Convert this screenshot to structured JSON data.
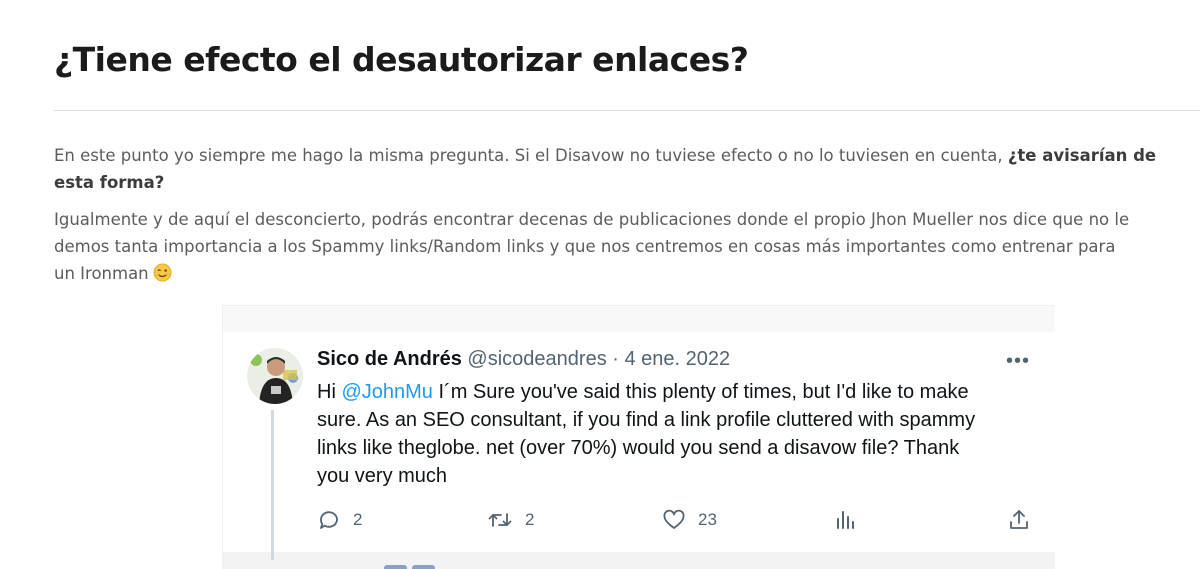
{
  "article": {
    "heading": "¿Tiene efecto el desautorizar enlaces?",
    "p1": {
      "text": "En este punto yo siempre me hago la misma pregunta. Si el Disavow no tuviese efecto o no lo tuviesen en cuenta, ",
      "bold_1": "¿te avisarían de",
      "bold_2": "esta forma?"
    },
    "p2": {
      "line_1": "Igualmente y de aquí el desconcierto, podrás encontrar decenas de publicaciones donde el propio Jhon Mueller nos dice que no le",
      "line_2": "demos tanta importancia a los Spammy links/Random links y que nos centremos en cosas más importantes como entrenar para",
      "line_3": "un Ironman"
    },
    "emoji": "winking-face-emoji"
  },
  "tweet": {
    "author_name": "Sico de Andrés",
    "handle": "@sicodeandres",
    "separator": "·",
    "date": "4 ene. 2022",
    "more_label": "•••",
    "text": {
      "hi": "Hi ",
      "mention": "@JohnMu",
      "line_1_rest": " I´m Sure you've said this plenty of times, but I'd like to make",
      "line_2": "sure. As an SEO consultant, if you find a link profile cluttered with spammy",
      "line_3": "links like theglobe. net (over 70%) would you send a disavow file? Thank",
      "line_4": "you very much"
    },
    "actions": {
      "replies": "2",
      "retweets": "2",
      "likes": "23"
    },
    "icons": {
      "reply": "reply-icon",
      "retweet": "retweet-icon",
      "like": "heart-icon",
      "views": "views-icon",
      "share": "share-icon"
    },
    "colors": {
      "mention": "#1d9bf0",
      "text": "#0f1419",
      "muted": "#536471"
    }
  }
}
